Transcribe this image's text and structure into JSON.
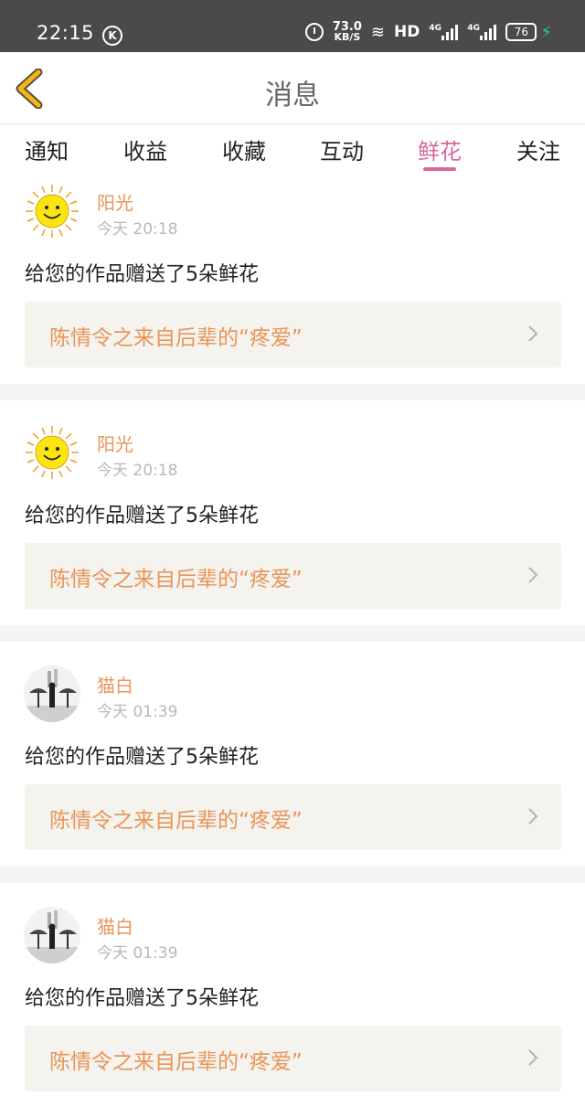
{
  "status_bar": {
    "time": "22:15",
    "k_icon": "K",
    "speed_value": "73.0",
    "speed_unit": "KB/S",
    "hd": "HD",
    "sig1": "4G",
    "sig2": "4G",
    "battery": "76"
  },
  "header": {
    "title": "消息"
  },
  "tabs": [
    {
      "label": "通知"
    },
    {
      "label": "收益"
    },
    {
      "label": "收藏"
    },
    {
      "label": "互动"
    },
    {
      "label": "鲜花",
      "active": true
    },
    {
      "label": "关注"
    }
  ],
  "messages": [
    {
      "user": "阳光",
      "time": "今天 20:18",
      "avatar": "sun-avatar",
      "text": "给您的作品赠送了5朵鲜花",
      "work": "陈情令之来自后辈的“疼爱”"
    },
    {
      "user": "阳光",
      "time": "今天 20:18",
      "avatar": "sun-avatar",
      "text": "给您的作品赠送了5朵鲜花",
      "work": "陈情令之来自后辈的“疼爱”"
    },
    {
      "user": "猫白",
      "time": "今天 01:39",
      "avatar": "umbrella-avatar",
      "text": "给您的作品赠送了5朵鲜花",
      "work": "陈情令之来自后辈的“疼爱”"
    },
    {
      "user": "猫白",
      "time": "今天 01:39",
      "avatar": "umbrella-avatar",
      "text": "给您的作品赠送了5朵鲜花",
      "work": "陈情令之来自后辈的“疼爱”"
    }
  ],
  "colors": {
    "accent": "#d9679a",
    "name": "#e8955a",
    "back": "#e0a21a"
  }
}
